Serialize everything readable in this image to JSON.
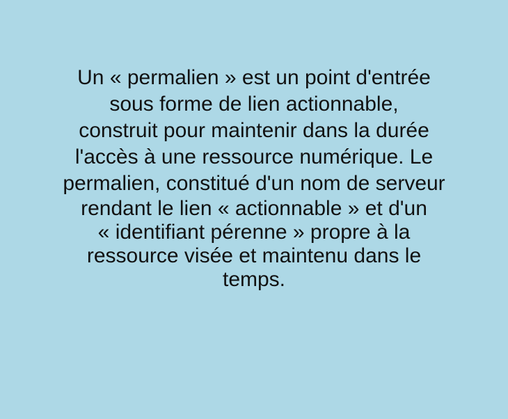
{
  "text": {
    "lines": [
      "Un « permalien » est un point d'entrée",
      "sous forme de lien actionnable,",
      "construit pour maintenir dans la durée",
      "l'accès à une ressource numérique. Le",
      "permalien, constitué d'un nom de serveur",
      "rendant le lien « actionnable » et d'un",
      "« identifiant pérenne » propre à la",
      "ressource visée et maintenu dans le",
      "temps."
    ]
  },
  "colors": {
    "background": "#add8e6",
    "text": "#111111"
  }
}
